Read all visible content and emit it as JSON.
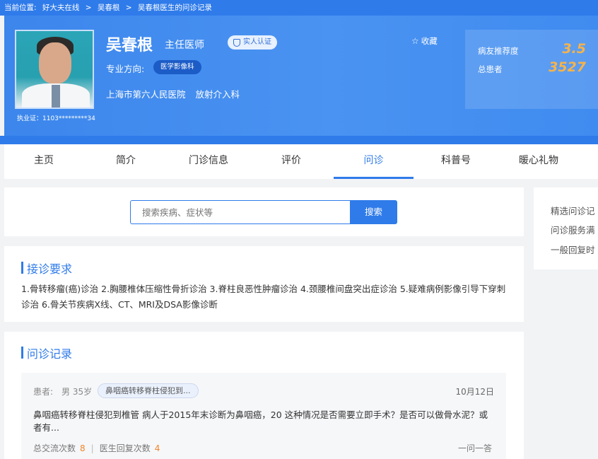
{
  "breadcrumb": {
    "label": "当前位置:",
    "items": [
      "好大夫在线",
      "吴春根",
      "吴春根医生的问诊记录"
    ],
    "separator": ">"
  },
  "doctor": {
    "name": "吴春根",
    "title": "主任医师",
    "verify_label": "实人认证",
    "specialty_label": "专业方向:",
    "specialty_tag": "医学影像科",
    "hospital": "上海市第六人民医院",
    "department": "放射介入科",
    "license": "执业证：1103*********34",
    "favorite_label": "收藏"
  },
  "stats": {
    "recommend_label": "病友推荐度",
    "recommend_value": "3.5",
    "patients_label": "总患者",
    "patients_value": "3527"
  },
  "tabs": [
    {
      "label": "主页"
    },
    {
      "label": "简介"
    },
    {
      "label": "门诊信息"
    },
    {
      "label": "评价"
    },
    {
      "label": "问诊"
    },
    {
      "label": "科普号"
    },
    {
      "label": "暖心礼物"
    }
  ],
  "active_tab": "问诊",
  "search": {
    "placeholder": "搜索疾病、症状等",
    "button_label": "搜索"
  },
  "side_menu": [
    "精选问诊记",
    "问诊服务满",
    "一般回复时"
  ],
  "requirements": {
    "title": "接诊要求",
    "text": "1.骨转移瘤(癌)诊治 2.胸腰椎体压缩性骨折诊治 3.脊柱良恶性肿瘤诊治 4.颈腰椎间盘突出症诊治 5.疑难病例影像引导下穿刺诊治 6.骨关节疾病X线、CT、MRI及DSA影像诊断"
  },
  "records": {
    "title": "问诊记录",
    "items": [
      {
        "patient_label": "患者:",
        "patient": "男 35岁",
        "tag": "鼻咽癌转移脊柱侵犯到...",
        "date": "10月12日",
        "text": "鼻咽癌转移脊柱侵犯到椎管 病人于2015年末诊断为鼻咽癌，20 这种情况是否需要立即手术？是否可以做骨水泥？或者有...",
        "exchange_label": "总交流次数",
        "exchange_count": "8",
        "reply_label": "医生回复次数",
        "reply_count": "4",
        "type": "一问一答"
      }
    ]
  },
  "colors": {
    "primary": "#2f7bea",
    "stat_value": "#f7b34a",
    "count": "#f0862b"
  }
}
